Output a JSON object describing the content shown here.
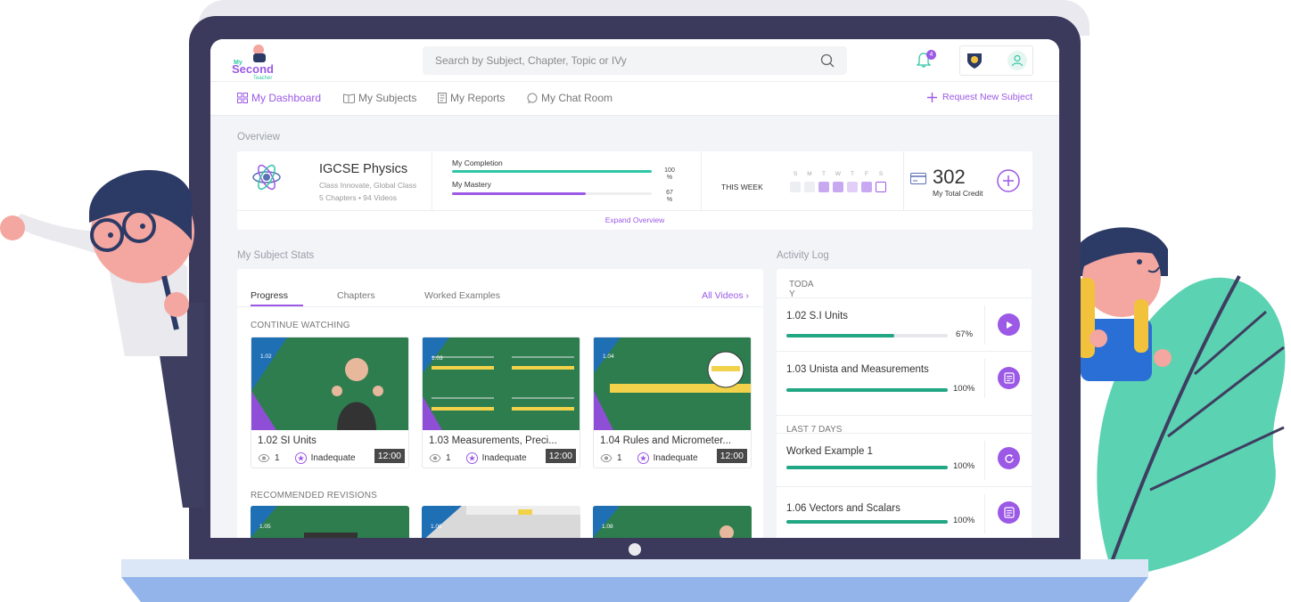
{
  "header": {
    "logo_text": "My Second Teacher",
    "search_placeholder": "Search by Subject, Chapter, Topic or IVy",
    "notification_count": "4"
  },
  "nav": {
    "items": [
      {
        "label": "My Dashboard",
        "active": true
      },
      {
        "label": "My Subjects",
        "active": false
      },
      {
        "label": "My Reports",
        "active": false
      },
      {
        "label": "My Chat Room",
        "active": false
      }
    ],
    "request_label": "Request New Subject"
  },
  "overview": {
    "section_title": "Overview",
    "subject": "IGCSE Physics",
    "class_info": "Class Innovate, Global Class",
    "chapters": "5 Chapters",
    "videos": "94 Videos",
    "completion_label": "My Completion",
    "completion_value": "100",
    "completion_pct": "%",
    "completion_fraction": 1.0,
    "mastery_label": "My Mastery",
    "mastery_value": "67",
    "mastery_pct": "%",
    "mastery_fraction": 0.67,
    "week_label": "THIS WEEK",
    "days": [
      "S",
      "M",
      "T",
      "W",
      "T",
      "F",
      "S"
    ],
    "credit_value": "302",
    "credit_label": "My Total Credit",
    "expand_label": "Expand Overview"
  },
  "stats": {
    "section_title": "My Subject Stats",
    "tabs": [
      "Progress",
      "Chapters",
      "Worked Examples"
    ],
    "all_videos": "All Videos",
    "continue_label": "CONTINUE WATCHING",
    "videos": [
      {
        "code": "1.02",
        "title": "1.02 SI Units",
        "duration": "12:00",
        "views": "1",
        "rating": "Inadequate"
      },
      {
        "code": "1.03",
        "title": "1.03 Measurements, Preci...",
        "duration": "12:00",
        "views": "1",
        "rating": "Inadequate"
      },
      {
        "code": "1.04",
        "title": "1.04 Rules and Micrometer...",
        "duration": "12:00",
        "views": "1",
        "rating": "Inadequate"
      }
    ],
    "recommended_label": "RECOMMENDED REVISIONS",
    "recommended": [
      {
        "code": "1.05"
      },
      {
        "code": "1.06"
      },
      {
        "code": "1.08"
      }
    ]
  },
  "activity": {
    "section_title": "Activity Log",
    "today_label": "TODA\nY",
    "last7_label": "LAST 7 DAYS",
    "items": [
      {
        "title": "1.02 S.I Units",
        "pct": "67%",
        "progress": 0.67,
        "icon": "play-icon"
      },
      {
        "title": "1.03 Unista and Measurements",
        "pct": "100%",
        "progress": 1.0,
        "icon": "notes-icon"
      },
      {
        "title": "Worked Example 1",
        "pct": "100%",
        "progress": 1.0,
        "icon": "refresh-icon"
      },
      {
        "title": "1.06 Vectors and Scalars",
        "pct": "100%",
        "progress": 1.0,
        "icon": "notes-icon"
      }
    ]
  },
  "colors": {
    "accent": "#9b59e6",
    "teal": "#2fc6a5",
    "green": "#22a785",
    "laptop": "#3c3a5c"
  }
}
